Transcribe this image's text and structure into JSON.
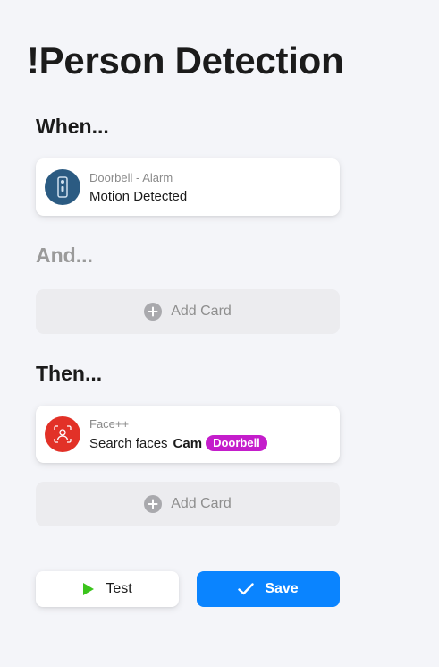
{
  "page": {
    "title": "!Person Detection"
  },
  "sections": {
    "when": {
      "heading": "When..."
    },
    "and": {
      "heading": "And..."
    },
    "then": {
      "heading": "Then..."
    }
  },
  "trigger_card": {
    "source": "Doorbell - Alarm",
    "event": "Motion Detected",
    "icon": "doorbell-icon",
    "icon_color": "#2b5b82"
  },
  "condition_add": {
    "label": "Add Card"
  },
  "action_card": {
    "source": "Face++",
    "action": "Search faces",
    "param_label": "Cam",
    "param_badge": "Doorbell",
    "badge_color": "#c41dcb",
    "icon": "face-scan-icon",
    "icon_color": "#e23127"
  },
  "action_add": {
    "label": "Add Card"
  },
  "buttons": {
    "test_label": "Test",
    "save_label": "Save",
    "save_color": "#0a84ff",
    "test_icon_color": "#3bc41c"
  }
}
